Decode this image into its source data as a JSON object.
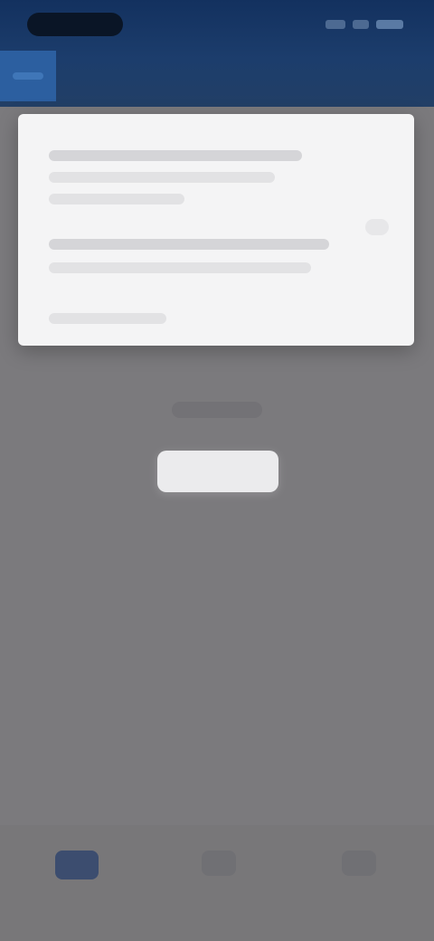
{
  "status_bar": {
    "time": "",
    "icons": [
      "signal-icon",
      "wifi-icon",
      "battery-icon"
    ]
  },
  "header": {
    "title": "",
    "active_tab_icon": "menu-icon"
  },
  "dialog": {
    "lines": [
      "",
      "",
      "",
      "",
      "",
      ""
    ]
  },
  "main": {
    "caption": "",
    "action_label": ""
  },
  "bottom_nav": {
    "items": [
      {
        "label": "",
        "icon": "home-icon"
      },
      {
        "label": "",
        "icon": "person-icon"
      },
      {
        "label": "",
        "icon": "settings-icon"
      }
    ]
  },
  "colors": {
    "header": "#13315f",
    "accent": "#2c5fa0",
    "overlay": "#7b7a7d",
    "dialog": "#f4f4f5"
  }
}
